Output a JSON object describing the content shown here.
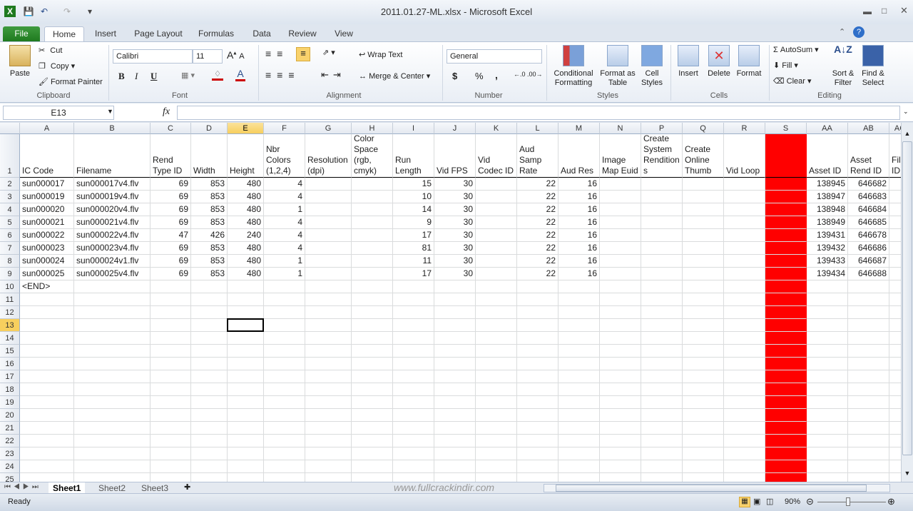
{
  "window": {
    "title": "2011.01.27-ML.xlsx - Microsoft Excel"
  },
  "qat": {
    "save_icon": "save-icon",
    "undo_icon": "undo-icon",
    "redo_icon": "redo-icon"
  },
  "tabs": [
    "File",
    "Home",
    "Insert",
    "Page Layout",
    "Formulas",
    "Data",
    "Review",
    "View"
  ],
  "ribbon": {
    "clipboard": {
      "paste": "Paste",
      "cut": "Cut",
      "copy": "Copy",
      "format_painter": "Format Painter",
      "label": "Clipboard"
    },
    "font": {
      "name": "Calibri",
      "size": "11",
      "bold": "B",
      "italic": "I",
      "underline": "U",
      "label": "Font"
    },
    "alignment": {
      "wrap": "Wrap Text",
      "merge": "Merge & Center",
      "label": "Alignment"
    },
    "number": {
      "format": "General",
      "currency": "$",
      "percent": "%",
      "comma": ",",
      "label": "Number"
    },
    "styles": {
      "conditional": "Conditional Formatting",
      "table": "Format as Table",
      "cell": "Cell Styles",
      "label": "Styles"
    },
    "cells": {
      "insert": "Insert",
      "delete": "Delete",
      "format": "Format",
      "label": "Cells"
    },
    "editing": {
      "autosum": "AutoSum",
      "fill": "Fill",
      "clear": "Clear",
      "sort": "Sort & Filter",
      "find": "Find & Select",
      "label": "Editing"
    }
  },
  "formula_bar": {
    "name_box": "E13",
    "fx": "fx",
    "value": ""
  },
  "columns": [
    "A",
    "B",
    "C",
    "D",
    "E",
    "F",
    "G",
    "H",
    "I",
    "J",
    "K",
    "L",
    "M",
    "N",
    "P",
    "Q",
    "R",
    "S",
    "AA",
    "AB",
    "AC"
  ],
  "selected_column": "E",
  "selected_cell": "E13",
  "highlight_column": "S",
  "highlight_color": "#ff0000",
  "headers": [
    "IC Code",
    "Filename",
    "Rend Type ID",
    "Width",
    "Height",
    "Nbr Colors (1,2,4)",
    "Resolution (dpi)",
    "Color Space (rgb, cmyk)",
    "Run Length",
    "Vid FPS",
    "Vid Codec ID",
    "Aud Samp Rate",
    "Aud Res",
    "Image Map Euid",
    "Create System Rendition s",
    "Create Online Thumb",
    "Vid Loop",
    "",
    "Asset ID",
    "Asset Rend ID",
    "File ID"
  ],
  "rows": [
    [
      "sun000017",
      "sun000017v4.flv",
      "69",
      "853",
      "480",
      "4",
      "",
      "",
      "15",
      "30",
      "",
      "22",
      "16",
      "",
      "",
      "",
      "",
      "",
      "138945",
      "646682",
      ""
    ],
    [
      "sun000019",
      "sun000019v4.flv",
      "69",
      "853",
      "480",
      "4",
      "",
      "",
      "10",
      "30",
      "",
      "22",
      "16",
      "",
      "",
      "",
      "",
      "",
      "138947",
      "646683",
      ""
    ],
    [
      "sun000020",
      "sun000020v4.flv",
      "69",
      "853",
      "480",
      "1",
      "",
      "",
      "14",
      "30",
      "",
      "22",
      "16",
      "",
      "",
      "",
      "",
      "",
      "138948",
      "646684",
      ""
    ],
    [
      "sun000021",
      "sun000021v4.flv",
      "69",
      "853",
      "480",
      "4",
      "",
      "",
      "9",
      "30",
      "",
      "22",
      "16",
      "",
      "",
      "",
      "",
      "",
      "138949",
      "646685",
      ""
    ],
    [
      "sun000022",
      "sun000022v4.flv",
      "47",
      "426",
      "240",
      "4",
      "",
      "",
      "17",
      "30",
      "",
      "22",
      "16",
      "",
      "",
      "",
      "",
      "",
      "139431",
      "646678",
      ""
    ],
    [
      "sun000023",
      "sun000023v4.flv",
      "69",
      "853",
      "480",
      "4",
      "",
      "",
      "81",
      "30",
      "",
      "22",
      "16",
      "",
      "",
      "",
      "",
      "",
      "139432",
      "646686",
      ""
    ],
    [
      "sun000024",
      "sun000024v1.flv",
      "69",
      "853",
      "480",
      "1",
      "",
      "",
      "11",
      "30",
      "",
      "22",
      "16",
      "",
      "",
      "",
      "",
      "",
      "139433",
      "646687",
      ""
    ],
    [
      "sun000025",
      "sun000025v4.flv",
      "69",
      "853",
      "480",
      "1",
      "",
      "",
      "17",
      "30",
      "",
      "22",
      "16",
      "",
      "",
      "",
      "",
      "",
      "139434",
      "646688",
      ""
    ],
    [
      "<END>"
    ]
  ],
  "sheets": [
    "Sheet1",
    "Sheet2",
    "Sheet3"
  ],
  "active_sheet": "Sheet1",
  "watermark": "www.fullcrackindir.com",
  "status": {
    "text": "Ready",
    "zoom": "90%",
    "zoom_percent": 90
  }
}
